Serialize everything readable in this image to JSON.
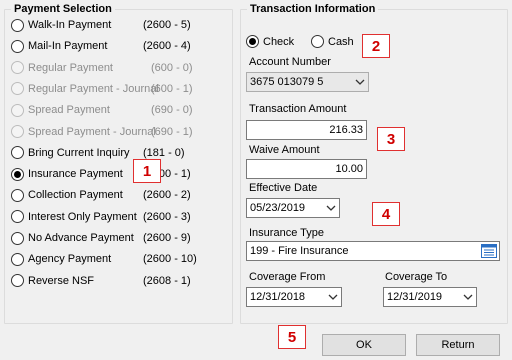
{
  "payment_selection": {
    "title": "Payment Selection",
    "options": [
      {
        "label": "Walk-In Payment",
        "code": "(2600 - 5)",
        "checked": false,
        "disabled": false
      },
      {
        "label": "Mail-In Payment",
        "code": "(2600 - 4)",
        "checked": false,
        "disabled": false
      },
      {
        "label": "Regular Payment",
        "code": "(600 - 0)",
        "checked": false,
        "disabled": true
      },
      {
        "label": "Regular Payment - Journal",
        "code": "(600 - 1)",
        "checked": false,
        "disabled": true
      },
      {
        "label": "Spread Payment",
        "code": "(690 - 0)",
        "checked": false,
        "disabled": true
      },
      {
        "label": "Spread Payment - Journal",
        "code": "(690 - 1)",
        "checked": false,
        "disabled": true
      },
      {
        "label": "Bring Current Inquiry",
        "code": "(181 - 0)",
        "checked": false,
        "disabled": false
      },
      {
        "label": "Insurance Payment",
        "code": "(2600 - 1)",
        "checked": true,
        "disabled": false
      },
      {
        "label": "Collection Payment",
        "code": "(2600 - 2)",
        "checked": false,
        "disabled": false
      },
      {
        "label": "Interest Only Payment",
        "code": "(2600 - 3)",
        "checked": false,
        "disabled": false
      },
      {
        "label": "No Advance Payment",
        "code": "(2600 - 9)",
        "checked": false,
        "disabled": false
      },
      {
        "label": "Agency Payment",
        "code": "(2600 - 10)",
        "checked": false,
        "disabled": false
      },
      {
        "label": "Reverse NSF",
        "code": "(2608 - 1)",
        "checked": false,
        "disabled": false
      }
    ]
  },
  "transaction": {
    "title": "Transaction Information",
    "method_check": "Check",
    "method_cash": "Cash",
    "account_number_label": "Account Number",
    "account_number_value": "3675 013079 5",
    "transaction_amount_label": "Transaction Amount",
    "transaction_amount_value": "216.33",
    "waive_amount_label": "Waive Amount",
    "waive_amount_value": "10.00",
    "effective_date_label": "Effective Date",
    "effective_date_value": "05/23/2019",
    "insurance_type_label": "Insurance Type",
    "insurance_type_value": "199 - Fire Insurance",
    "coverage_from_label": "Coverage From",
    "coverage_from_value": "12/31/2018",
    "coverage_to_label": "Coverage To",
    "coverage_to_value": "12/31/2019"
  },
  "callouts": [
    "1",
    "2",
    "3",
    "4",
    "5"
  ],
  "buttons": {
    "ok": "OK",
    "return": "Return"
  },
  "colors": {
    "callout_border": "#e03030",
    "callout_text": "#d00000"
  }
}
